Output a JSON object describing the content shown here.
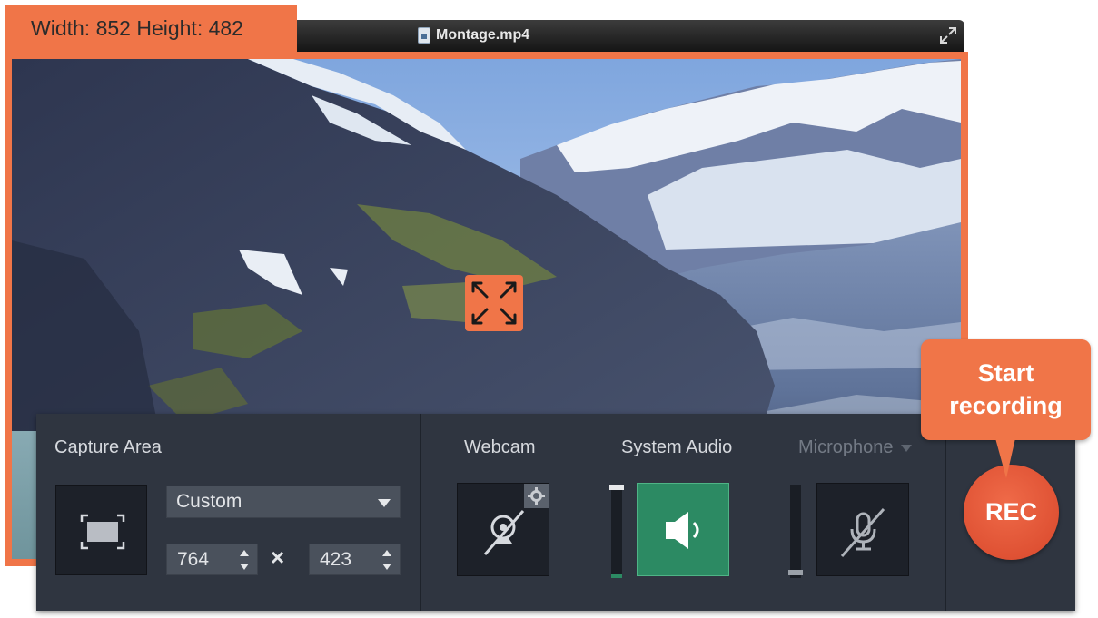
{
  "window": {
    "title": "Montage.mp4",
    "size_label": "Width: 852 Height: 482"
  },
  "capture": {
    "label": "Capture Area",
    "preset": "Custom",
    "width_value": "764",
    "height_value": "423",
    "times_symbol": "×"
  },
  "webcam": {
    "label": "Webcam",
    "enabled": false
  },
  "system_audio": {
    "label": "System Audio",
    "enabled": true,
    "level": 0.05
  },
  "microphone": {
    "label": "Microphone",
    "enabled": false,
    "level": 0.05
  },
  "record": {
    "button_label": "REC",
    "tooltip": [
      "Start",
      "recording"
    ]
  },
  "colors": {
    "accent": "#f07548",
    "panel": "#2f3540",
    "active_green": "#2c8a63",
    "rec_red": "#e05634"
  },
  "icons": [
    "file-icon",
    "expand-icon",
    "move-handle-icon",
    "capture-area-icon",
    "webcam-off-icon",
    "gear-icon",
    "speaker-icon",
    "microphone-off-icon",
    "chevron-down-icon"
  ]
}
